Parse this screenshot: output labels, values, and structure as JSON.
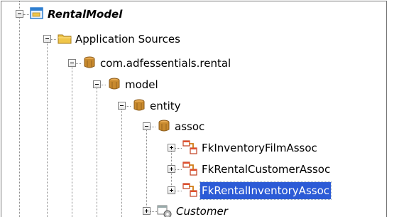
{
  "tree": {
    "root": {
      "label": "RentalModel"
    },
    "application_sources": {
      "label": "Application Sources"
    },
    "package": {
      "label": "com.adfessentials.rental"
    },
    "model": {
      "label": "model"
    },
    "entity": {
      "label": "entity"
    },
    "assoc": {
      "label": "assoc"
    },
    "assoc_items": [
      {
        "label": "FkInventoryFilmAssoc"
      },
      {
        "label": "FkRentalCustomerAssoc"
      },
      {
        "label": "FkRentalInventoryAssoc",
        "selected": true
      }
    ],
    "customer": {
      "label": "Customer"
    }
  },
  "colors": {
    "selection": "#2c5bd6",
    "package_icon": "#c88a2e",
    "folder_icon": "#f0c64a",
    "project_icon": "#2f7fd0"
  }
}
